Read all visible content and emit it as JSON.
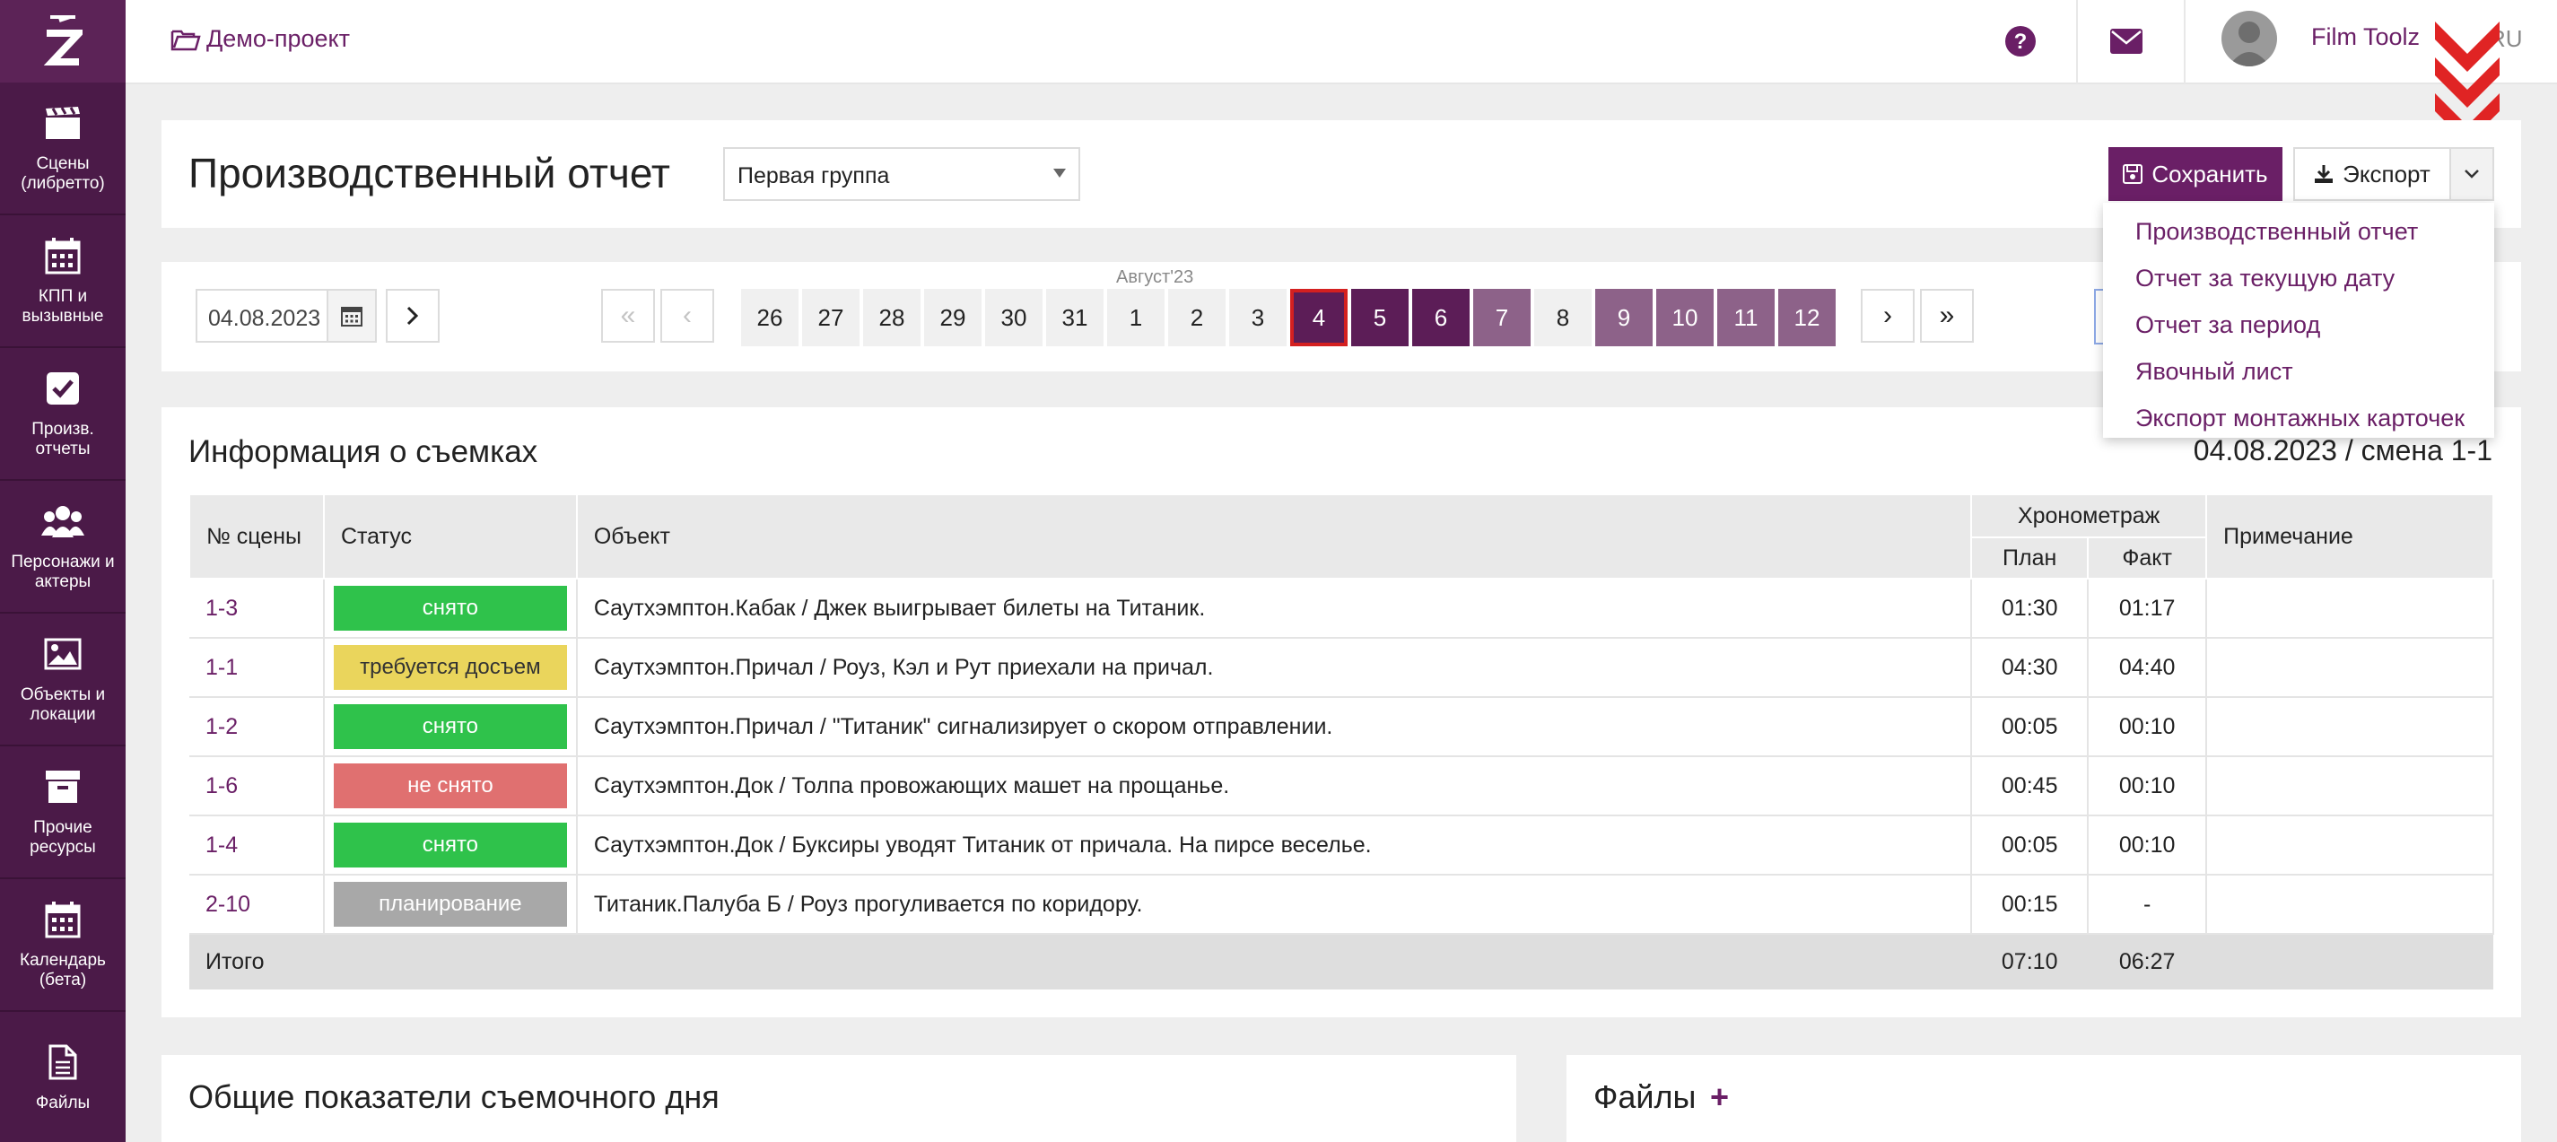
{
  "sidebar": {
    "items": [
      {
        "label": "Сцены (либретто)",
        "icon": "clapperboard-icon"
      },
      {
        "label": "КПП и вызывные",
        "icon": "calendar-icon"
      },
      {
        "label": "Произв. отчеты",
        "icon": "checkbox-icon"
      },
      {
        "label": "Персонажи и актеры",
        "icon": "people-icon"
      },
      {
        "label": "Объекты и локации",
        "icon": "image-icon"
      },
      {
        "label": "Прочие ресурсы",
        "icon": "archive-box-icon"
      },
      {
        "label": "Календарь (бета)",
        "icon": "calendar-grid-icon"
      },
      {
        "label": "Файлы",
        "icon": "file-icon"
      }
    ]
  },
  "topbar": {
    "project": "Демо-проект",
    "user_name": "Film Toolz",
    "lang": "RU"
  },
  "header": {
    "title": "Производственный отчет",
    "group_select": "Первая группа",
    "save_label": "Сохранить",
    "export_label": "Экспорт"
  },
  "export_menu": {
    "items": [
      "Производственный отчет",
      "Отчет за текущую дату",
      "Отчет за период",
      "Явочный лист",
      "Экспорт монтажных карточек"
    ]
  },
  "date_nav": {
    "date": "04.08.2023",
    "month": "Август'23",
    "first": "«",
    "prev": "‹",
    "next": "›",
    "last": "»",
    "days": [
      {
        "n": "26",
        "state": "plain"
      },
      {
        "n": "27",
        "state": "plain"
      },
      {
        "n": "28",
        "state": "plain"
      },
      {
        "n": "29",
        "state": "plain"
      },
      {
        "n": "30",
        "state": "plain"
      },
      {
        "n": "31",
        "state": "plain"
      },
      {
        "n": "1",
        "state": "plain"
      },
      {
        "n": "2",
        "state": "plain"
      },
      {
        "n": "3",
        "state": "plain"
      },
      {
        "n": "4",
        "state": "selected"
      },
      {
        "n": "5",
        "state": "dark"
      },
      {
        "n": "6",
        "state": "dark"
      },
      {
        "n": "7",
        "state": "mid"
      },
      {
        "n": "8",
        "state": "plain"
      },
      {
        "n": "9",
        "state": "mid"
      },
      {
        "n": "10",
        "state": "mid"
      },
      {
        "n": "11",
        "state": "mid"
      },
      {
        "n": "12",
        "state": "mid"
      }
    ]
  },
  "info": {
    "title": "Информация о съемках",
    "shift": "04.08.2023 / смена 1-1",
    "headers": {
      "scene": "№ сцены",
      "status": "Статус",
      "object": "Объект",
      "timing": "Хронометраж",
      "plan": "План",
      "fact": "Факт",
      "note": "Примечание"
    },
    "rows": [
      {
        "scene": "1-3",
        "status": "снято",
        "status_color": "#2fc24b",
        "object": "Саутхэмптон.Кабак / Джек выигрывает билеты на Титаник.",
        "plan": "01:30",
        "fact": "01:17",
        "note": ""
      },
      {
        "scene": "1-1",
        "status": "требуется досъем",
        "status_color": "#ead55c",
        "object": "Саутхэмптон.Причал / Роуз, Кэл и Рут приехали на причал.",
        "plan": "04:30",
        "fact": "04:40",
        "note": ""
      },
      {
        "scene": "1-2",
        "status": "снято",
        "status_color": "#2fc24b",
        "object": "Саутхэмптон.Причал / \"Титаник\" сигнализирует о скором отправлении.",
        "plan": "00:05",
        "fact": "00:10",
        "note": ""
      },
      {
        "scene": "1-6",
        "status": "не снято",
        "status_color": "#e07070",
        "object": "Саутхэмптон.Док / Толпа провожающих машет на прощанье.",
        "plan": "00:45",
        "fact": "00:10",
        "note": ""
      },
      {
        "scene": "1-4",
        "status": "снято",
        "status_color": "#2fc24b",
        "object": "Саутхэмптон.Док / Буксиры уводят Титаник от причала. На пирсе веселье.",
        "plan": "00:05",
        "fact": "00:10",
        "note": ""
      },
      {
        "scene": "2-10",
        "status": "планирование",
        "status_color": "#a8a8a8",
        "object": "Титаник.Палуба Б / Роуз прогуливается по коридору.",
        "plan": "00:15",
        "fact": "-",
        "note": ""
      }
    ],
    "total": {
      "label": "Итого",
      "plan": "07:10",
      "fact": "06:27"
    }
  },
  "bottom": {
    "left_title": "Общие показатели съемочного дня",
    "right_title": "Файлы",
    "add": "+"
  }
}
